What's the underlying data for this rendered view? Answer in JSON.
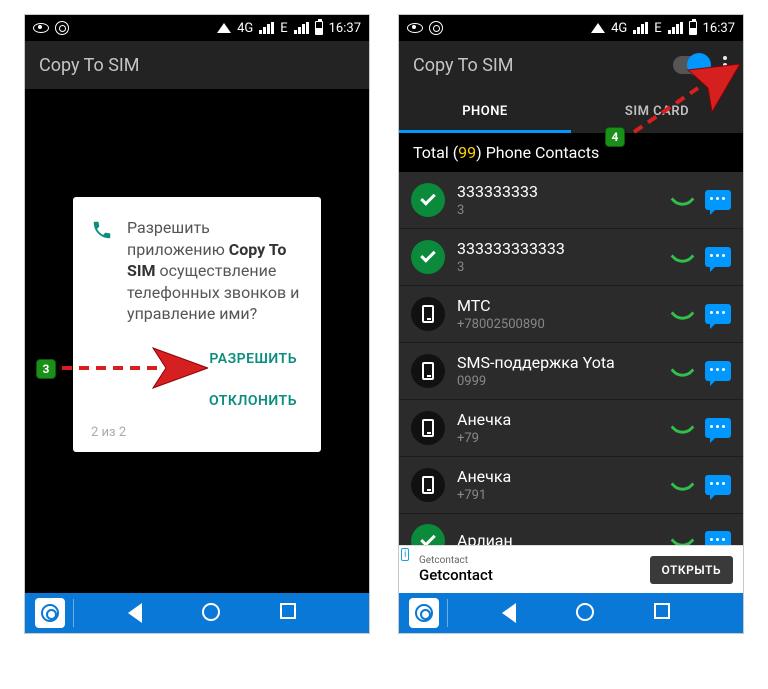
{
  "status": {
    "network": "4G",
    "extra": "E",
    "time": "16:37"
  },
  "app": {
    "title": "Copy To SIM"
  },
  "tabs": {
    "phone": "PHONE",
    "sim": "SIM CARD"
  },
  "total": {
    "prefix": "Total (",
    "count": "99",
    "suffix": ") Phone Contacts"
  },
  "contacts": [
    {
      "name": "333333333",
      "sub": "3",
      "selected": true,
      "avatar": "check"
    },
    {
      "name": "333333333333",
      "sub": "3",
      "selected": true,
      "avatar": "check"
    },
    {
      "name": "МТС",
      "sub": "+78002500890",
      "selected": false,
      "avatar": "phone"
    },
    {
      "name": "SMS-поддержка Yota",
      "sub": "0999",
      "selected": false,
      "avatar": "phone"
    },
    {
      "name": "Анечка",
      "sub": "+79",
      "selected": false,
      "avatar": "phone"
    },
    {
      "name": "Анечка",
      "sub": "+791",
      "selected": false,
      "avatar": "phone"
    },
    {
      "name": "Арлиан",
      "sub": "",
      "selected": false,
      "avatar": "check"
    }
  ],
  "ad": {
    "mark": "i",
    "sub": "Getcontact",
    "title": "Getcontact",
    "button": "ОТКРЫТЬ"
  },
  "dialog": {
    "msg_pre": "Разрешить приложению ",
    "msg_bold": "Copy To SIM",
    "msg_post": " осуществление телефонных звонков и управление ими?",
    "allow": "РАЗРЕШИТЬ",
    "deny": "ОТКЛОНИТЬ",
    "counter": "2 из 2"
  },
  "callout": {
    "step3": "3",
    "step4": "4"
  }
}
